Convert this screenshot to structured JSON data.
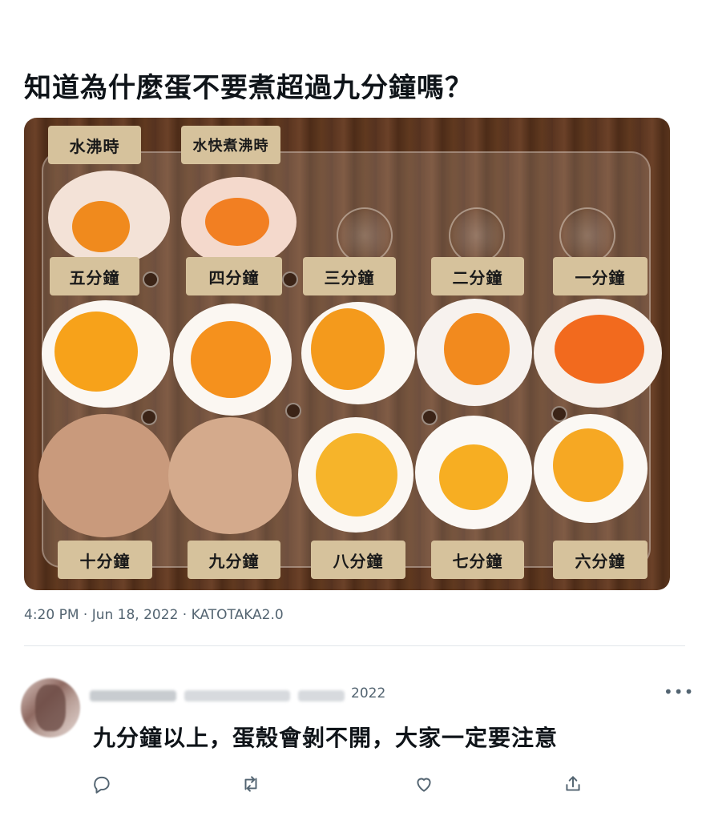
{
  "post": {
    "headline": "知道為什麼蛋不要煮超過九分鐘嗎？",
    "meta": "4:20 PM · Jun 18, 2022 · KATOTAKA2.0"
  },
  "image": {
    "top_labels": [
      "水沸時",
      "水快煮沸時"
    ],
    "row1_labels": [
      "五分鐘",
      "四分鐘",
      "三分鐘",
      "二分鐘",
      "一分鐘"
    ],
    "row2_labels": [
      "十分鐘",
      "九分鐘",
      "八分鐘",
      "七分鐘",
      "六分鐘"
    ]
  },
  "reply": {
    "date": "2022",
    "text": "九分鐘以上，蛋殼會剝不開，大家一定要注意",
    "more_label": "•••"
  },
  "icons": [
    "reply-icon",
    "retweet-icon",
    "like-icon",
    "share-icon",
    "more-icon"
  ],
  "colors": {
    "text": "#0f1419",
    "muted": "#536471",
    "label_bg": "#d6c29c",
    "wood": "#5a3520"
  }
}
